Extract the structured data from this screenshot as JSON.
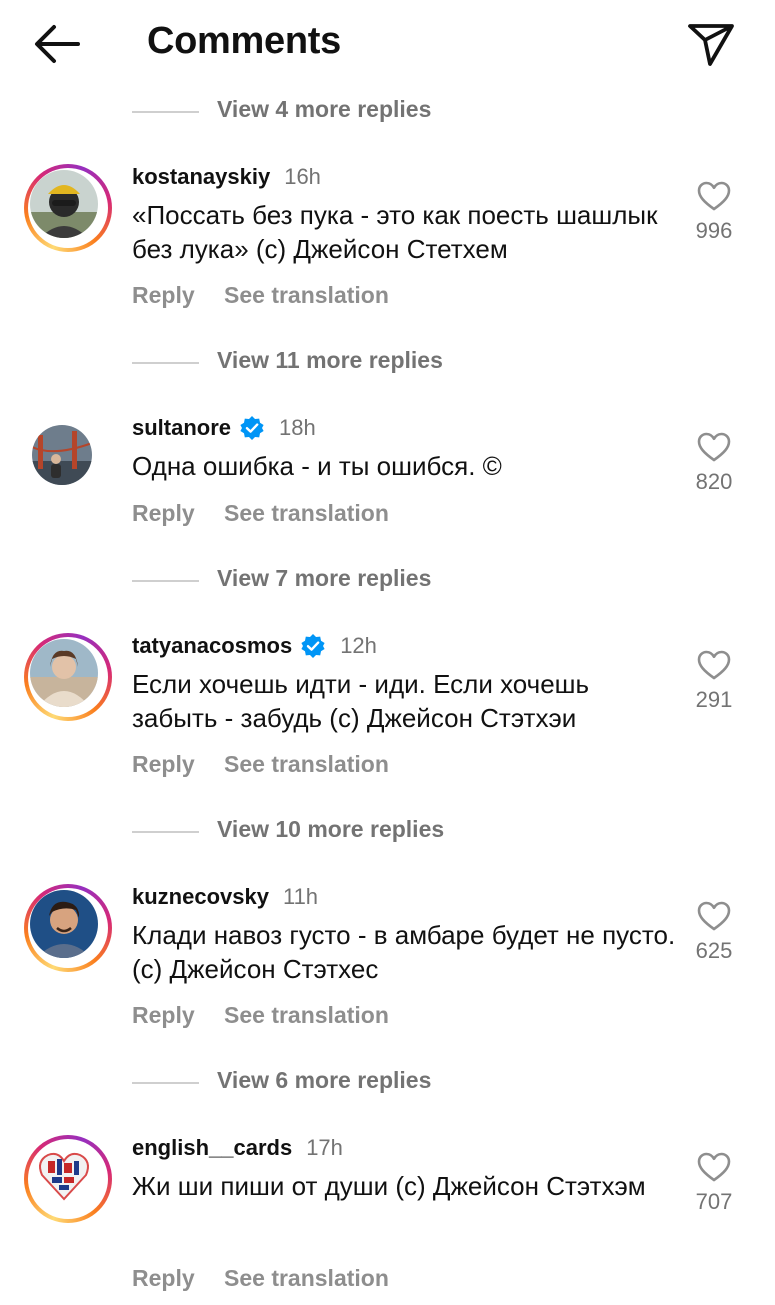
{
  "header": {
    "title": "Comments"
  },
  "threads": [
    {
      "view_more": "View 4 more replies"
    },
    {
      "view_more": "View 11 more replies"
    },
    {
      "view_more": "View 7 more replies"
    },
    {
      "view_more": "View 10 more replies"
    },
    {
      "view_more": "View 6 more replies"
    }
  ],
  "comments": [
    {
      "username": "kostanayskiy",
      "verified": false,
      "time": "16h",
      "text": "«Поссать без пука - это как поесть шашлык без лука» (с) Джейсон Стетхем",
      "likes": "996",
      "reply": "Reply",
      "translate": "See translation"
    },
    {
      "username": "sultanore",
      "verified": true,
      "time": "18h",
      "text": "Одна ошибка - и ты ошибся. ©",
      "likes": "820",
      "reply": "Reply",
      "translate": "See translation"
    },
    {
      "username": "tatyanacosmos",
      "verified": true,
      "time": "12h",
      "text": "Если хочешь идти - иди. Если хочешь забыть - забудь (с) Джейсон Стэтхэи",
      "likes": "291",
      "reply": "Reply",
      "translate": "See translation"
    },
    {
      "username": "kuznecovsky",
      "verified": false,
      "time": "11h",
      "text": "Клади навоз густо - в амбаре будет не пусто. (с) Джейсон Стэтхес",
      "likes": "625",
      "reply": "Reply",
      "translate": "See translation"
    },
    {
      "username": "english__cards",
      "verified": false,
      "time": "17h",
      "text": "Жи ши пиши от души (с) Джейсон Стэтхэм",
      "likes": "707",
      "reply": "Reply",
      "translate": "See translation"
    }
  ],
  "colors": {
    "verified": "#0095f6",
    "muted": "#737373",
    "text": "#111111"
  }
}
